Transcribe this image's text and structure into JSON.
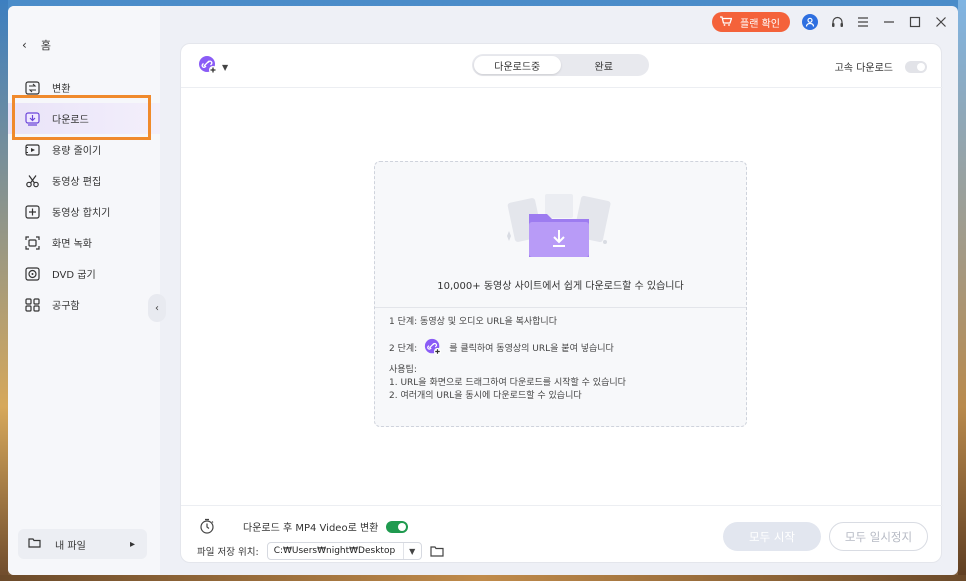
{
  "sidebar": {
    "home_label": "홈",
    "items": [
      {
        "label": "변환",
        "icon": "convert-icon"
      },
      {
        "label": "다운로드",
        "icon": "download-icon",
        "active": true
      },
      {
        "label": "용량 줄이기",
        "icon": "compress-icon"
      },
      {
        "label": "동영상 편집",
        "icon": "scissors-icon"
      },
      {
        "label": "동영상 합치기",
        "icon": "merge-icon"
      },
      {
        "label": "화면 녹화",
        "icon": "screen-record-icon"
      },
      {
        "label": "DVD 굽기",
        "icon": "disc-icon"
      },
      {
        "label": "공구함",
        "icon": "toolbox-icon"
      }
    ],
    "my_files_label": "내 파일"
  },
  "titlebar": {
    "plan_button_label": "플랜 확인",
    "plan_color": "#f4623a"
  },
  "header": {
    "tabs": [
      {
        "label": "다운로드중",
        "selected": true
      },
      {
        "label": "완료",
        "selected": false
      }
    ],
    "turbo_label": "고속 다운로드",
    "turbo_enabled": false
  },
  "dropzone": {
    "title": "10,000+ 동영상 사이트에서 쉽게 다운로드할 수 있습니다",
    "step1": "1 단계: 동영상 및 오디오 URL을 복사합니다",
    "step2_prefix": "2 단계:",
    "step2_suffix": "를 클릭하여 동영상의 URL을 붙여 넣습니다",
    "tips_title": "사용팁:",
    "tip1": "1. URL을 화면으로 드래그하여 다운로드를 시작할 수 있습니다",
    "tip2": "2. 여러개의 URL을 동시에 다운로드할 수 있습니다"
  },
  "footer": {
    "convert_label": "다운로드 후 MP4 Video로 변환",
    "convert_enabled": true,
    "save_label": "파일 저장 위치:",
    "save_path": "C:₩Users₩night₩Desktop",
    "start_all": "모두 시작",
    "pause_all": "모두 일시정지"
  },
  "colors": {
    "accent": "#8a5cf6",
    "toggle_on": "#1f9a4f",
    "highlight_outline": "#f08a2c"
  }
}
